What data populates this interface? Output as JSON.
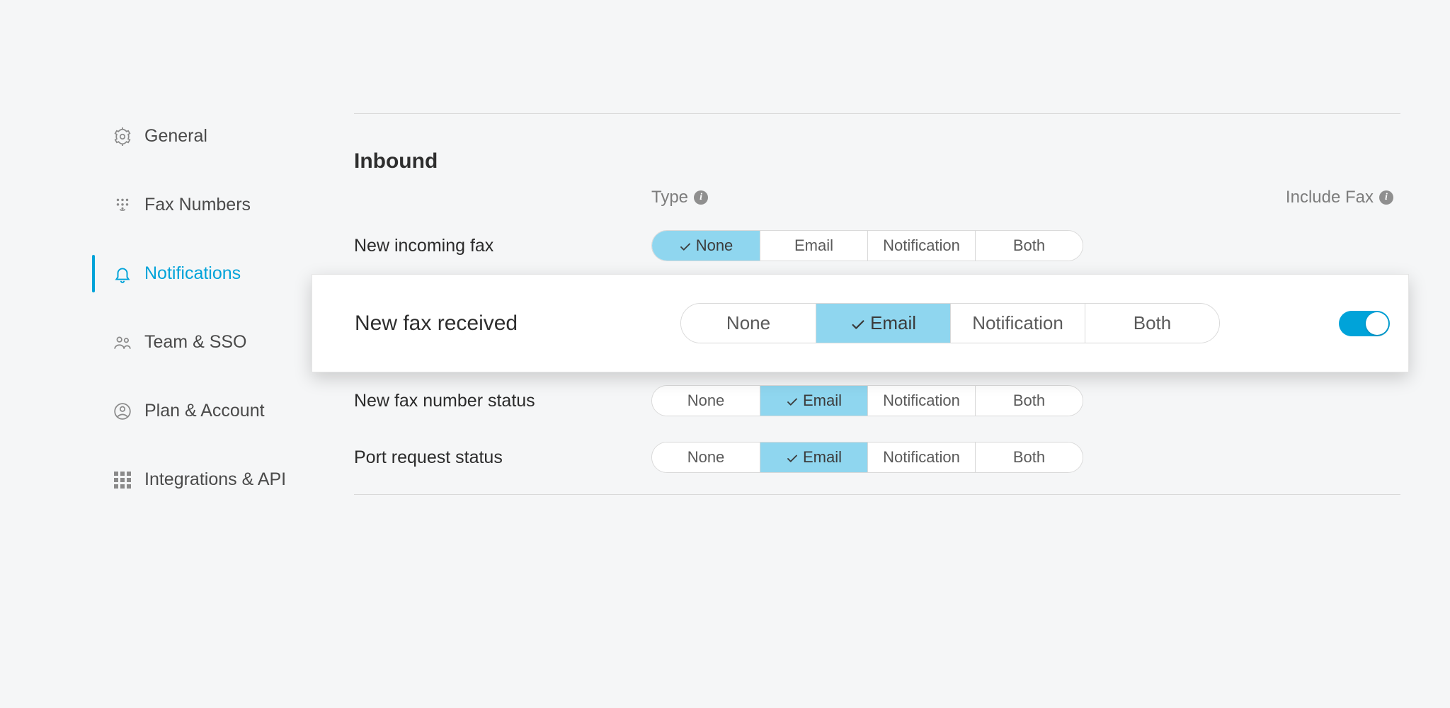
{
  "sidebar": {
    "items": [
      {
        "label": "General"
      },
      {
        "label": "Fax Numbers"
      },
      {
        "label": "Notifications"
      },
      {
        "label": "Team & SSO"
      },
      {
        "label": "Plan & Account"
      },
      {
        "label": "Integrations & API"
      }
    ],
    "active_index": 2
  },
  "section": {
    "title": "Inbound",
    "type_header": "Type",
    "include_header": "Include Fax"
  },
  "options": {
    "none": "None",
    "email": "Email",
    "notification": "Notification",
    "both": "Both"
  },
  "rows": [
    {
      "label": "New incoming fax",
      "selected": "none"
    },
    {
      "label": "New fax received",
      "selected": "email",
      "include_fax": true
    },
    {
      "label": "New fax number status",
      "selected": "email"
    },
    {
      "label": "Port request status",
      "selected": "email"
    }
  ]
}
